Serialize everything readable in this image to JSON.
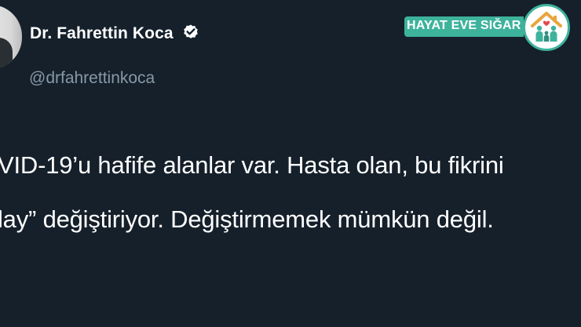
{
  "tweet": {
    "display_name": "Dr. Fahrettin Koca",
    "handle": "@drfahrettinkoca",
    "verified": true,
    "text_lines": [
      "VID-19’u hafife alanlar var. Hasta olan, bu fikrini",
      "lay” değiştiriyor. Değiştirmemek mümkün değil."
    ]
  },
  "campaign": {
    "label": "HAYAT EVE SIĞAR",
    "logo_icon": "home-family-icon",
    "accent_color": "#3eb39c"
  },
  "colors": {
    "background": "#15202b",
    "name_text": "#ffffff",
    "handle_text": "#8899a6",
    "body_text": "#ffffff"
  }
}
